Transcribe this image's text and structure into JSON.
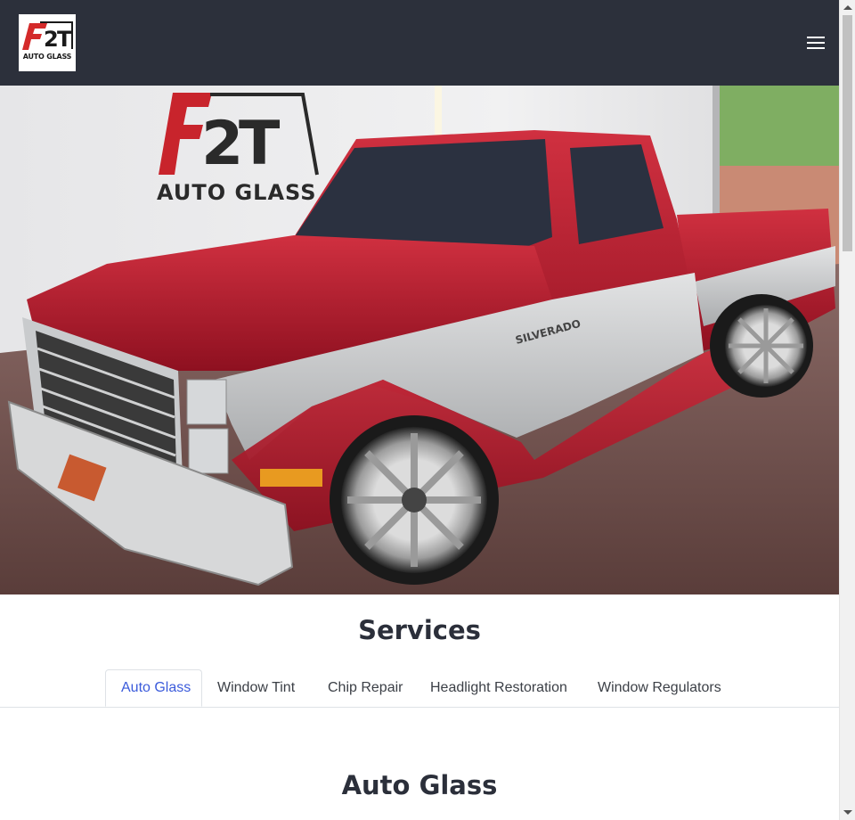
{
  "brand": {
    "logo_mark": "F2T",
    "logo_text": "AUTO GLASS",
    "wall_logo_text": "AUTO GLASS"
  },
  "navbar": {
    "menu_icon": "hamburger-menu-icon"
  },
  "hero": {
    "image_subject": "red-and-silver-pickup-truck",
    "badge_text": "SILVERADO"
  },
  "services": {
    "title": "Services",
    "tabs": [
      {
        "label": "Auto Glass",
        "active": true
      },
      {
        "label": "Window Tint",
        "active": false
      },
      {
        "label": "Chip Repair",
        "active": false
      },
      {
        "label": "Headlight Restoration",
        "active": false
      },
      {
        "label": "Window Regulators",
        "active": false
      }
    ],
    "active_section_title": "Auto Glass"
  },
  "colors": {
    "navbar_bg": "#2c303b",
    "active_tab": "#3b5bdb",
    "heading": "#2b2f3a",
    "truck_red": "#b3182a",
    "truck_silver": "#c9cbcd"
  }
}
